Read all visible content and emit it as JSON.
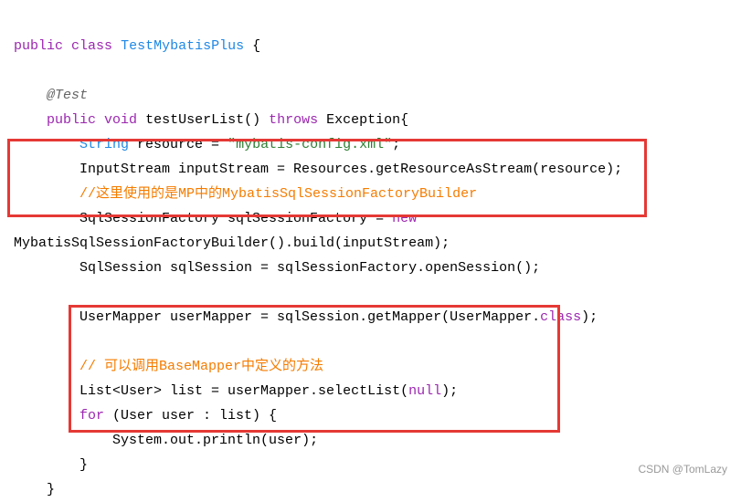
{
  "code": {
    "line1_public": "public",
    "line1_class": "class",
    "line1_classname": "TestMybatisPlus",
    "line1_brace": " {",
    "line2_annotation": "@Test",
    "line3_public": "public",
    "line3_void": "void",
    "line3_method": " testUserList() ",
    "line3_throws": "throws",
    "line3_exc": " Exception{",
    "line4_type": "String",
    "line4_var": " resource = ",
    "line4_string": "\"mybatis-config.xml\"",
    "line4_semi": ";",
    "line5": "InputStream inputStream = Resources.getResourceAsStream(resource);",
    "line6_comment": "//这里使用的是MP中的MybatisSqlSessionFactoryBuilder",
    "line7_a": "SqlSessionFactory sqlSessionFactory = ",
    "line7_new": "new",
    "line8": "MybatisSqlSessionFactoryBuilder().build(inputStream);",
    "line9": "SqlSession sqlSession = sqlSessionFactory.openSession();",
    "line10_a": "UserMapper userMapper = sqlSession.getMapper(UserMapper.",
    "line10_class": "class",
    "line10_b": ");",
    "line11_comment": "// 可以调用BaseMapper中定义的方法",
    "line12_a": "List<User> list = userMapper.selectList(",
    "line12_null": "null",
    "line12_b": ");",
    "line13_for": "for",
    "line13_a": " (User user : list) {",
    "line14": "System.out.println(user);",
    "line15": "}",
    "line16": "}"
  },
  "watermark": "CSDN @TomLazy"
}
